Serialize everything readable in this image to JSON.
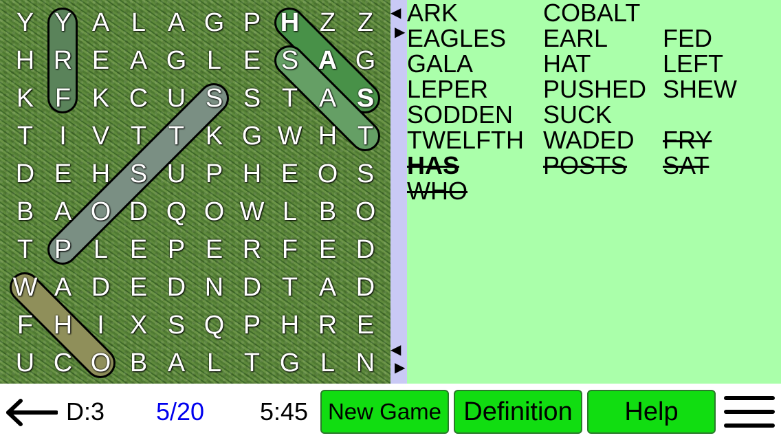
{
  "grid": [
    [
      "Y",
      "Y",
      "A",
      "L",
      "A",
      "G",
      "P",
      "H",
      "Z",
      "Z"
    ],
    [
      "H",
      "R",
      "E",
      "A",
      "G",
      "L",
      "E",
      "S",
      "A",
      "G"
    ],
    [
      "K",
      "F",
      "K",
      "C",
      "U",
      "S",
      "S",
      "T",
      "A",
      "S"
    ],
    [
      "T",
      "I",
      "V",
      "T",
      "T",
      "K",
      "G",
      "W",
      "H",
      "T"
    ],
    [
      "D",
      "E",
      "H",
      "S",
      "U",
      "P",
      "H",
      "E",
      "O",
      "S"
    ],
    [
      "B",
      "A",
      "O",
      "D",
      "Q",
      "O",
      "W",
      "L",
      "B",
      "O"
    ],
    [
      "T",
      "P",
      "L",
      "E",
      "P",
      "E",
      "R",
      "F",
      "E",
      "D"
    ],
    [
      "W",
      "A",
      "D",
      "E",
      "D",
      "N",
      "D",
      "T",
      "A",
      "D"
    ],
    [
      "F",
      "H",
      "I",
      "X",
      "S",
      "Q",
      "P",
      "H",
      "R",
      "E"
    ],
    [
      "U",
      "C",
      "O",
      "B",
      "A",
      "L",
      "T",
      "G",
      "L",
      "N"
    ]
  ],
  "bold_cells": [
    "0-7",
    "1-8",
    "2-9"
  ],
  "words": [
    {
      "text": "ARK",
      "found": false
    },
    {
      "text": "COBALT",
      "found": false
    },
    {
      "text": "EAGLES",
      "found": false
    },
    {
      "text": "EARL",
      "found": false
    },
    {
      "text": "FED",
      "found": false
    },
    {
      "text": "GALA",
      "found": false
    },
    {
      "text": "HAT",
      "found": false
    },
    {
      "text": "LEFT",
      "found": false
    },
    {
      "text": "LEPER",
      "found": false
    },
    {
      "text": "PUSHED",
      "found": false
    },
    {
      "text": "SHEW",
      "found": false
    },
    {
      "text": "SODDEN",
      "found": false
    },
    {
      "text": "SUCK",
      "found": false
    },
    {
      "text": "TWELFTH",
      "found": false
    },
    {
      "text": "WADED",
      "found": false
    },
    {
      "text": "FRY",
      "found": true,
      "bold": false
    },
    {
      "text": "HAS",
      "found": true,
      "bold": true
    },
    {
      "text": "POSTS",
      "found": true,
      "bold": false
    },
    {
      "text": "SAT",
      "found": true,
      "bold": false
    },
    {
      "text": "WHO",
      "found": true,
      "bold": false
    }
  ],
  "highlight_colors": {
    "fry": "#6a9a6a",
    "has": "#55aa55",
    "sat": "#77bb77",
    "posts": "#8fa89a",
    "who": "#a8a86a"
  },
  "status": {
    "back_icon": "left-arrow-icon",
    "difficulty": "D:3",
    "progress": "5/20",
    "progress_color": "#0000ee",
    "timer": "5:45"
  },
  "buttons": {
    "new_game": "New Game",
    "definition": "Definition",
    "help": "Help",
    "menu_icon": "hamburger-menu-icon"
  },
  "scroll_arrows": {
    "up_left": "◀",
    "up_right": "▶",
    "down_left": "◀",
    "down_right": "▶"
  }
}
